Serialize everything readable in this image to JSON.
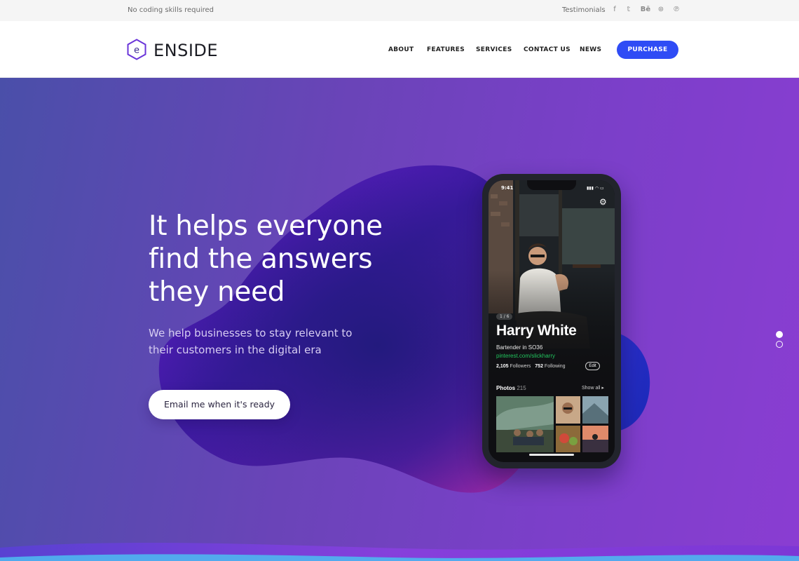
{
  "topbar": {
    "tagline": "No coding skills required",
    "testimonials_label": "Testimonials",
    "social": [
      {
        "name": "facebook-icon",
        "glyph": "f"
      },
      {
        "name": "twitter-icon",
        "glyph": "𝕥"
      },
      {
        "name": "behance-icon",
        "glyph": "Bē"
      },
      {
        "name": "dribbble-icon",
        "glyph": "⊛"
      },
      {
        "name": "pinterest-icon",
        "glyph": "℗"
      }
    ]
  },
  "header": {
    "logo_letter": "e",
    "logo_text": "ENSIDE",
    "nav": [
      "ABOUT",
      "FEATURES",
      "SERVICES",
      "CONTACT US",
      "NEWS"
    ],
    "purchase_label": "PURCHASE"
  },
  "hero": {
    "headline_lines": [
      "It helps everyone",
      "find the answers",
      "they need"
    ],
    "subline_lines": [
      "We help businesses to stay relevant to",
      "their customers in the digital era"
    ],
    "cta_label": "Email me when it's ready"
  },
  "phone": {
    "time": "9:41",
    "status_icons": "▮▮▮ ◠ ▭",
    "page_indicator": "1 / 6",
    "name": "Harry White",
    "role": "Bartender in SO36",
    "link": "pinterest.com/slickharry",
    "followers_count": "2,105",
    "followers_label": "Followers",
    "following_count": "752",
    "following_label": "Following",
    "edit_label": "Edit",
    "photos_label": "Photos",
    "photos_count": "215",
    "show_all_label": "Show all ▸"
  },
  "slider_dots": {
    "count": 2,
    "active_index": 0
  },
  "colors": {
    "accent": "#2f4cf5",
    "hero_left": "#4a4fa9",
    "hero_right": "#8a3dd2",
    "link_green": "#22c55e"
  }
}
